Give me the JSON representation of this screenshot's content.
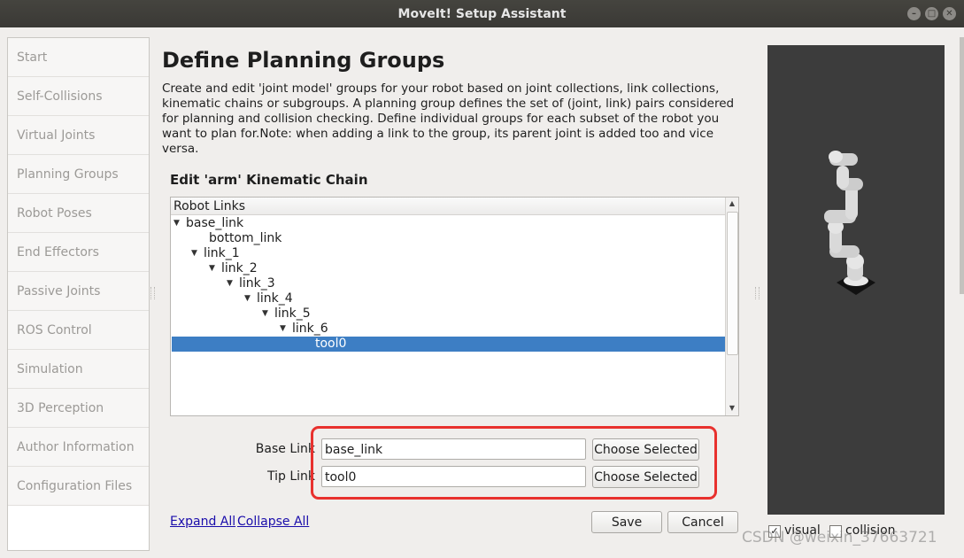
{
  "window": {
    "title": "MoveIt! Setup Assistant"
  },
  "sidebar": {
    "items": [
      {
        "label": "Start"
      },
      {
        "label": "Self-Collisions"
      },
      {
        "label": "Virtual Joints"
      },
      {
        "label": "Planning Groups"
      },
      {
        "label": "Robot Poses"
      },
      {
        "label": "End Effectors"
      },
      {
        "label": "Passive Joints"
      },
      {
        "label": "ROS Control"
      },
      {
        "label": "Simulation"
      },
      {
        "label": "3D Perception"
      },
      {
        "label": "Author Information"
      },
      {
        "label": "Configuration Files"
      }
    ]
  },
  "main": {
    "title": "Define Planning Groups",
    "description": "Create and edit 'joint model' groups for your robot based on joint collections, link collections, kinematic chains or subgroups. A planning group defines the set of (joint, link) pairs considered for planning and collision checking. Define individual groups for each subset of the robot you want to plan for.Note: when adding a link to the group, its parent joint is added too and vice versa.",
    "chain_title": "Edit 'arm' Kinematic Chain"
  },
  "tree": {
    "header": "Robot Links",
    "nodes": [
      {
        "label": "base_link",
        "expanded": true
      },
      {
        "label": "bottom_link",
        "expanded": false
      },
      {
        "label": "link_1",
        "expanded": true
      },
      {
        "label": "link_2",
        "expanded": true
      },
      {
        "label": "link_3",
        "expanded": true
      },
      {
        "label": "link_4",
        "expanded": true
      },
      {
        "label": "link_5",
        "expanded": true
      },
      {
        "label": "link_6",
        "expanded": true
      },
      {
        "label": "tool0",
        "expanded": false,
        "selected": true
      }
    ]
  },
  "form": {
    "base_label": "Base Link",
    "base_value": "base_link",
    "tip_label": "Tip Link",
    "tip_value": "tool0",
    "choose_label": "Choose Selected"
  },
  "footer": {
    "expand_all": "Expand All",
    "collapse_all": "Collapse All",
    "save": "Save",
    "cancel": "Cancel"
  },
  "viewport": {
    "visual_label": "visual",
    "visual_checked": true,
    "collision_label": "collision",
    "collision_checked": false
  },
  "watermark": "CSDN @weixin_37663721",
  "colors": {
    "selection": "#3d7ec4",
    "highlight_box": "#e8312e",
    "viewport_bg": "#3c3c3c"
  }
}
